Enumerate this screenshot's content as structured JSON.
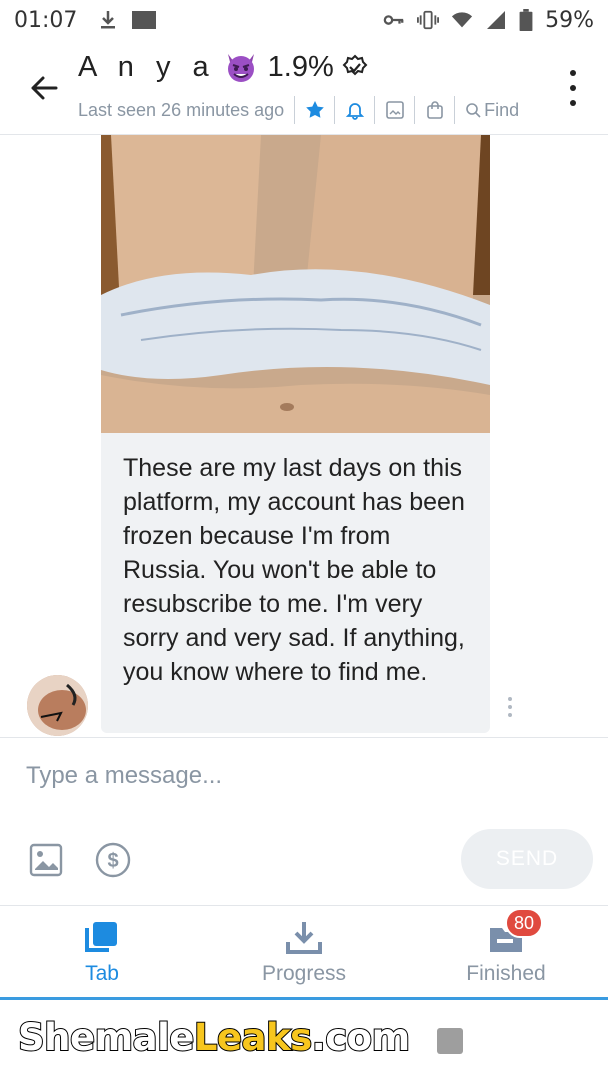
{
  "status_bar": {
    "time": "01:07",
    "battery": "59%"
  },
  "header": {
    "name": "A n y a",
    "percent": "1.9%",
    "last_seen": "Last seen 26 minutes ago",
    "find_label": "Find",
    "accent": "#1d8be0"
  },
  "message": {
    "text": "These are my last days on this platform, my account has been frozen because I'm from Russia. You won't be able to resubscribe to me. I'm very sorry and very sad. If anything, you know where to find me."
  },
  "composer": {
    "placeholder": "Type a message...",
    "send_label": "SEND"
  },
  "tabs": [
    {
      "label": "Tab",
      "icon": "tabs-icon",
      "active": true
    },
    {
      "label": "Progress",
      "icon": "download-icon"
    },
    {
      "label": "Finished",
      "icon": "folder-icon",
      "badge": "80"
    }
  ],
  "watermark": {
    "part1": "Shemale",
    "part2": "Leaks",
    "part3": ".com"
  }
}
